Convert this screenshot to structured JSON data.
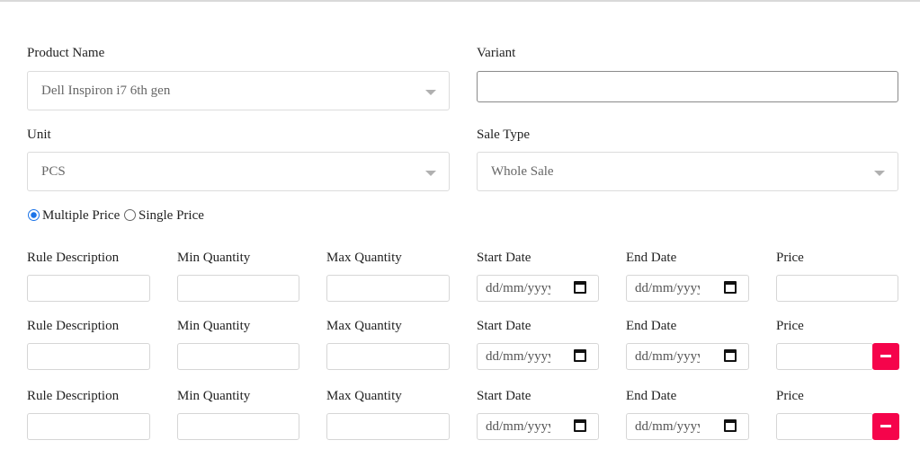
{
  "form": {
    "product_name_label": "Product Name",
    "product_name_value": "Dell Inspiron i7 6th gen",
    "variant_label": "Variant",
    "variant_value": "",
    "unit_label": "Unit",
    "unit_value": "PCS",
    "sale_type_label": "Sale Type",
    "sale_type_value": "Whole Sale",
    "price_mode": {
      "options": [
        "Multiple Price",
        "Single Price"
      ],
      "selected": "Multiple Price"
    },
    "rows": [
      {
        "rule_label": "Rule Description",
        "min_label": "Min Quantity",
        "max_label": "Max Quantity",
        "start_label": "Start Date",
        "end_label": "End Date",
        "price_label": "Price",
        "start_placeholder": "dd/mm/yyyy",
        "end_placeholder": "dd/mm/yyyy"
      },
      {
        "rule_label": "Rule Description",
        "min_label": "Min Quantity",
        "max_label": "Max Quantity",
        "start_label": "Start Date",
        "end_label": "End Date",
        "price_label": "Price",
        "start_placeholder": "dd/mm/yyyy",
        "end_placeholder": "dd/mm/yyyy"
      },
      {
        "rule_label": "Rule Description",
        "min_label": "Min Quantity",
        "max_label": "Max Quantity",
        "start_label": "Start Date",
        "end_label": "End Date",
        "price_label": "Price",
        "start_placeholder": "dd/mm/yyyy",
        "end_placeholder": "dd/mm/yyyy"
      }
    ]
  },
  "icons": {
    "dropdown": "chevron-down-icon",
    "calendar": "calendar-icon",
    "remove": "minus-icon"
  },
  "colors": {
    "remove_button": "#f5044b",
    "radio_selected": "#1a73e8"
  }
}
